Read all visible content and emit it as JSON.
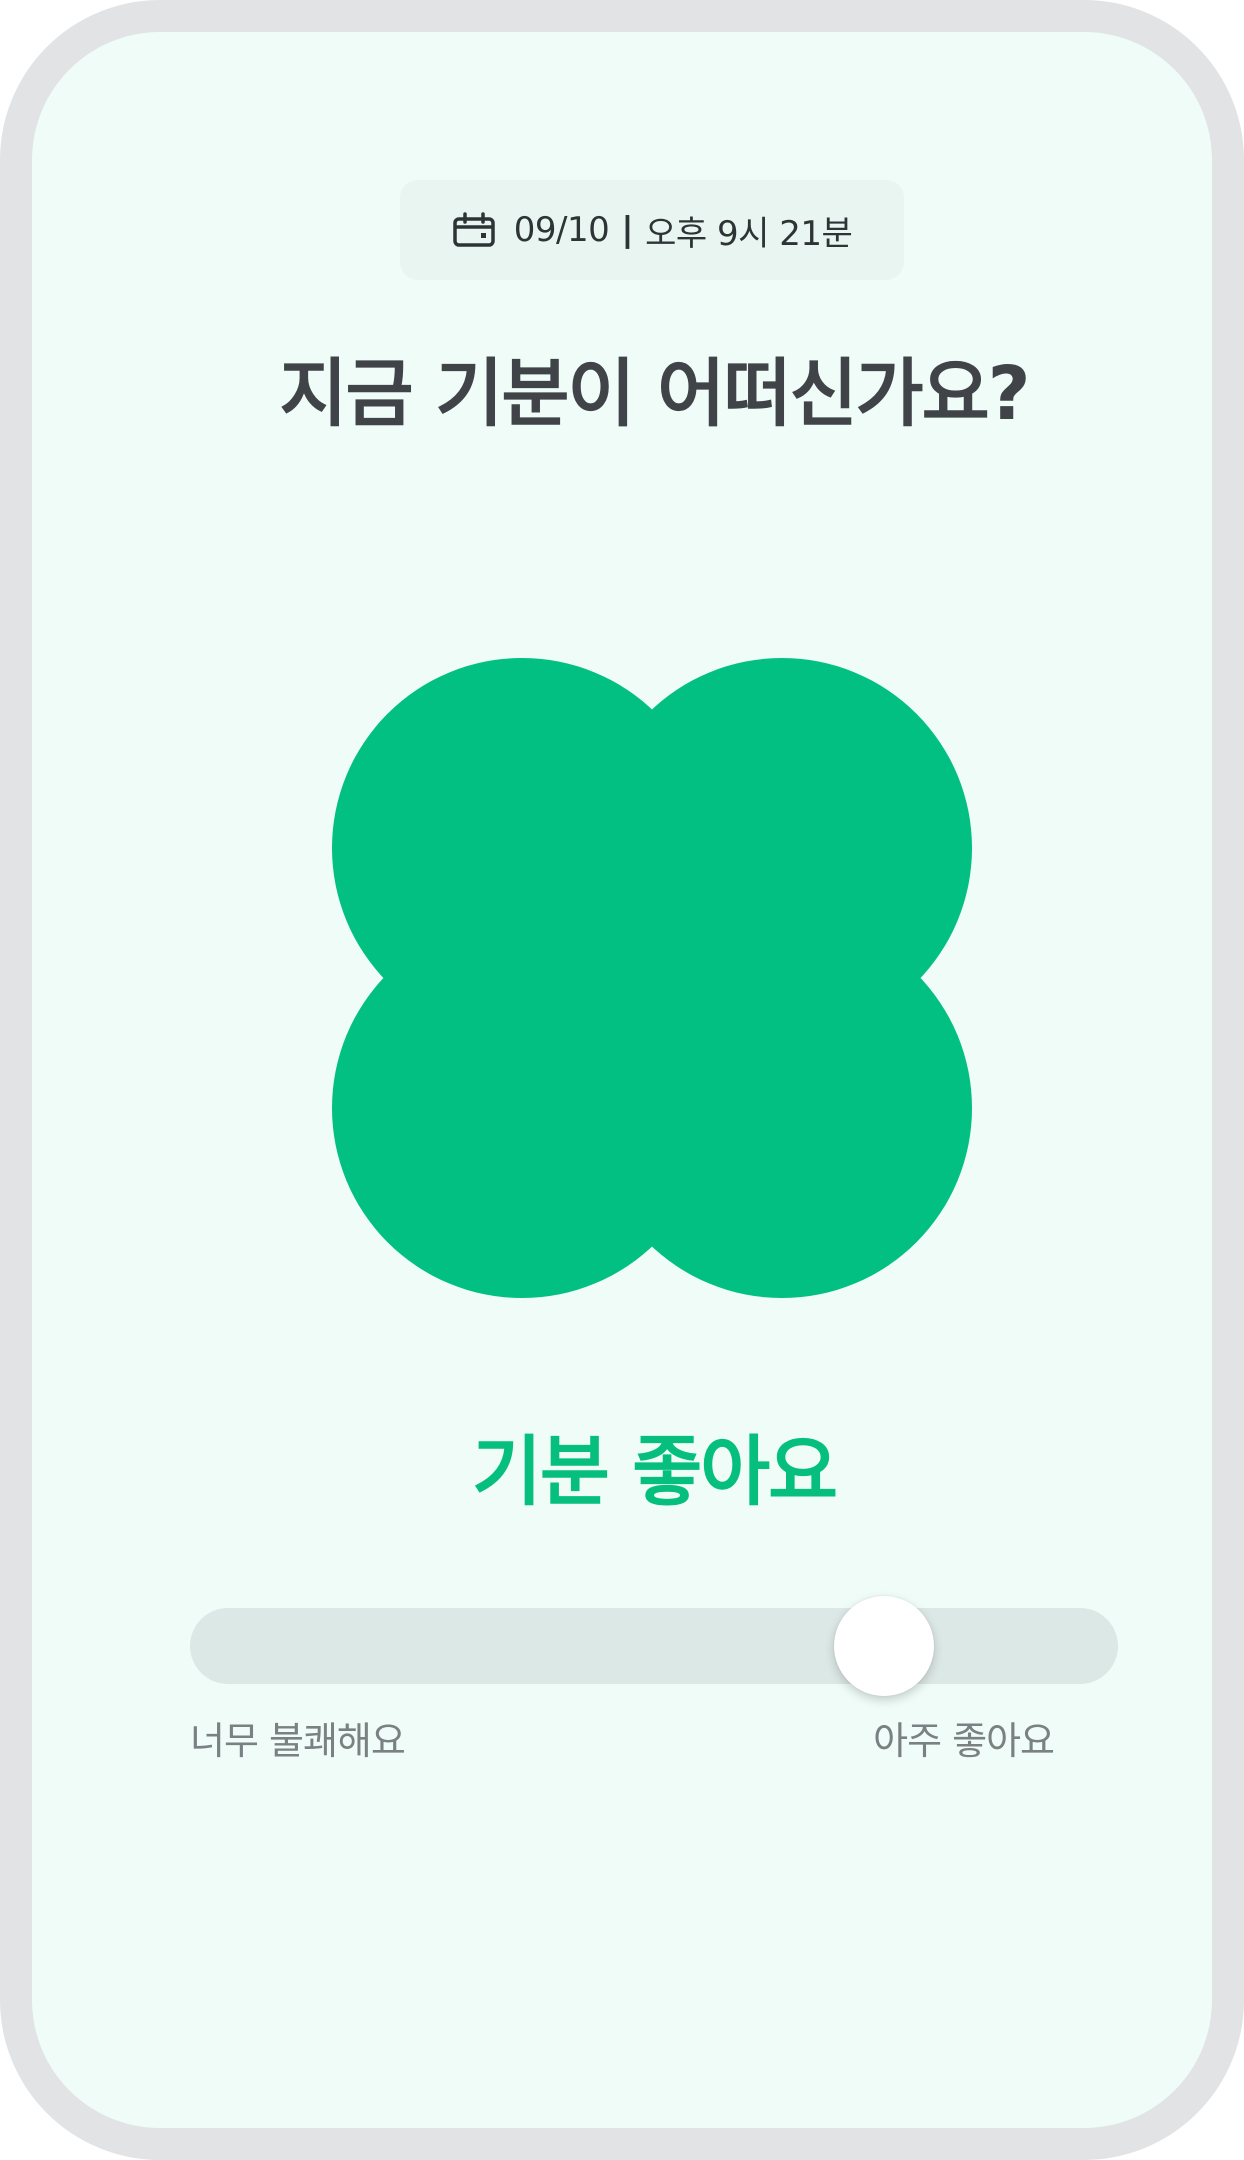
{
  "header": {
    "date": "09/10",
    "separator": "|",
    "time": "오후 9시 21분",
    "calendar_icon": "calendar-icon"
  },
  "prompt": {
    "question": "지금 기분이 어떠신가요?"
  },
  "mood": {
    "label": "기분 좋아요",
    "shape": "clover-four-circles",
    "color": "#02c081"
  },
  "slider": {
    "value": 0.77,
    "min_label": "너무 불쾌해요",
    "max_label": "아주 좋아요",
    "track_color": "#dce8e5",
    "thumb_color": "#ffffff"
  },
  "theme": {
    "background": "#effcf7",
    "frame": "#e1e3e5",
    "accent": "#06bf7f",
    "text_dark": "#404448",
    "text_muted": "#7b8083"
  }
}
